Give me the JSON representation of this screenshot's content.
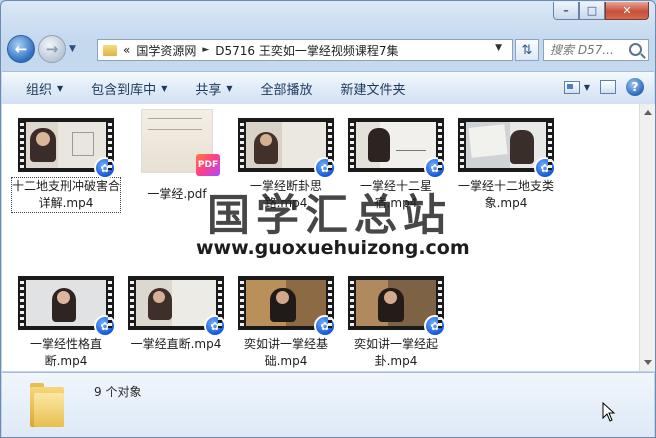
{
  "window": {
    "caption_buttons": [
      "–",
      "□",
      "✕"
    ]
  },
  "address": {
    "overflow": "«",
    "crumbs": [
      "国学资源网",
      "D5716 王奕如一掌经视频课程7集"
    ]
  },
  "search": {
    "placeholder": "搜索 D57..."
  },
  "toolbar": {
    "organize": "组织",
    "include_in_library": "包含到库中",
    "share": "共享",
    "play_all": "全部播放",
    "new_folder": "新建文件夹",
    "help": "?"
  },
  "files": [
    {
      "label": "十二地支刑冲破害合详解.mp4",
      "type": "video",
      "selected": true
    },
    {
      "label": "一掌经.pdf",
      "type": "pdf",
      "badge": "PDF"
    },
    {
      "label": "一掌经断卦思路.mp4",
      "type": "video"
    },
    {
      "label": "一掌经十二星宿.mp4",
      "type": "video"
    },
    {
      "label": "一掌经十二地支类象.mp4",
      "type": "video"
    },
    {
      "label": "一掌经性格直断.mp4",
      "type": "video"
    },
    {
      "label": "一掌经直断.mp4",
      "type": "video"
    },
    {
      "label": "奕如讲一掌经基础.mp4",
      "type": "video"
    },
    {
      "label": "奕如讲一掌经起卦.mp4",
      "type": "video"
    }
  ],
  "watermark": {
    "title": "国学汇总站",
    "url": "www.guoxuehuizong.com"
  },
  "details": {
    "count": "9 个对象"
  },
  "colors": {
    "accent": "#1557d6",
    "chrome": "#c4d8ee"
  }
}
